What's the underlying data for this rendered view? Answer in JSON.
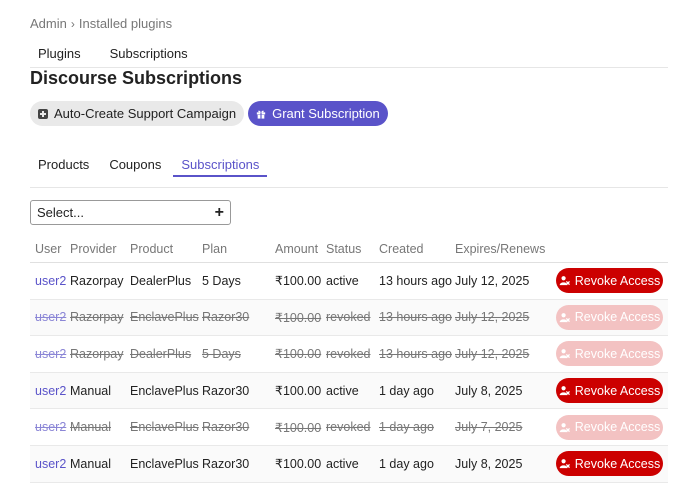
{
  "breadcrumb": {
    "root": "Admin",
    "current": "Installed plugins"
  },
  "top_nav": [
    {
      "label": "Plugins"
    },
    {
      "label": "Subscriptions"
    }
  ],
  "page_title": "Discourse Subscriptions",
  "actions": {
    "auto_create": "Auto-Create Support Campaign",
    "grant": "Grant Subscription"
  },
  "sub_nav": [
    {
      "label": "Products"
    },
    {
      "label": "Coupons"
    },
    {
      "label": "Subscriptions"
    }
  ],
  "filter": {
    "value": "Select..."
  },
  "columns": [
    "User",
    "Provider",
    "Product",
    "Plan",
    "Amount",
    "Status",
    "Created",
    "Expires/Renews"
  ],
  "rows": [
    {
      "user": "user2",
      "provider": "Razorpay",
      "product": "DealerPlus",
      "plan": "5 Days",
      "amount": "₹100.00",
      "status": "active",
      "created": "13 hours ago",
      "expires": "July 12, 2025",
      "action": "Revoke Access"
    },
    {
      "user": "user2",
      "provider": "Razorpay",
      "product": "EnclavePlus",
      "plan": "Razor30",
      "amount": "₹100.00",
      "status": "revoked",
      "created": "13 hours ago",
      "expires": "July 12, 2025",
      "action": "Revoke Access"
    },
    {
      "user": "user2",
      "provider": "Razorpay",
      "product": "DealerPlus",
      "plan": "5 Days",
      "amount": "₹100.00",
      "status": "revoked",
      "created": "13 hours ago",
      "expires": "July 12, 2025",
      "action": "Revoke Access"
    },
    {
      "user": "user2",
      "provider": "Manual",
      "product": "EnclavePlus",
      "plan": "Razor30",
      "amount": "₹100.00",
      "status": "active",
      "created": "1 day ago",
      "expires": "July 8, 2025",
      "action": "Revoke Access"
    },
    {
      "user": "user2",
      "provider": "Manual",
      "product": "EnclavePlus",
      "plan": "Razor30",
      "amount": "₹100.00",
      "status": "revoked",
      "created": "1 day ago",
      "expires": "July 7, 2025",
      "action": "Revoke Access"
    },
    {
      "user": "user2",
      "provider": "Manual",
      "product": "EnclavePlus",
      "plan": "Razor30",
      "amount": "₹100.00",
      "status": "active",
      "created": "1 day ago",
      "expires": "July 8, 2025",
      "action": "Revoke Access"
    }
  ],
  "colors": {
    "accent": "#5a53c9",
    "danger": "#cc0000",
    "danger_disabled": "#f3c2c2"
  }
}
